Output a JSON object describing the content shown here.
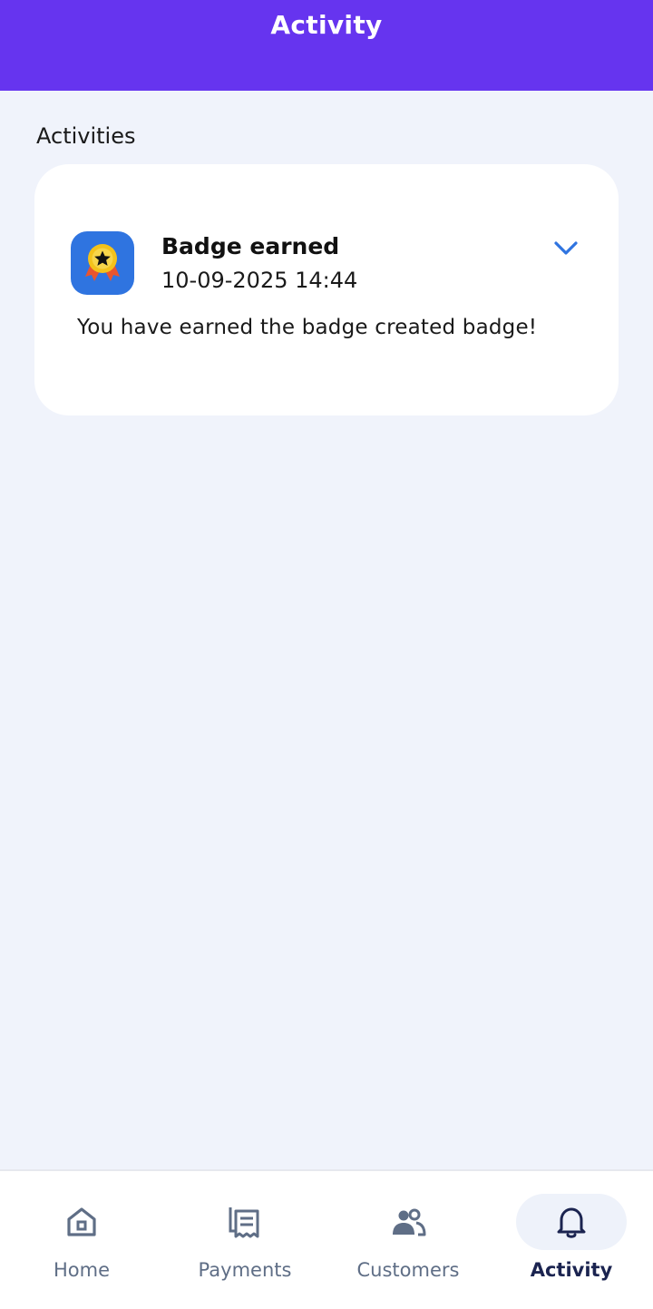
{
  "header": {
    "title": "Activity",
    "background": "#6634ef"
  },
  "section": {
    "label": "Activities"
  },
  "activity": {
    "title": "Badge earned",
    "timestamp": "10-09-2025 14:44",
    "message": "You have earned the badge created badge!",
    "icon": "medal-icon",
    "expand_icon": "chevron-down-icon",
    "accent": "#2f74e0"
  },
  "nav": {
    "items": [
      {
        "label": "Home",
        "icon": "home-icon",
        "active": false
      },
      {
        "label": "Payments",
        "icon": "receipt-icon",
        "active": false
      },
      {
        "label": "Customers",
        "icon": "people-icon",
        "active": false
      },
      {
        "label": "Activity",
        "icon": "bell-icon",
        "active": true
      }
    ],
    "active_color": "#1b2450",
    "inactive_color": "#5f6e86"
  }
}
